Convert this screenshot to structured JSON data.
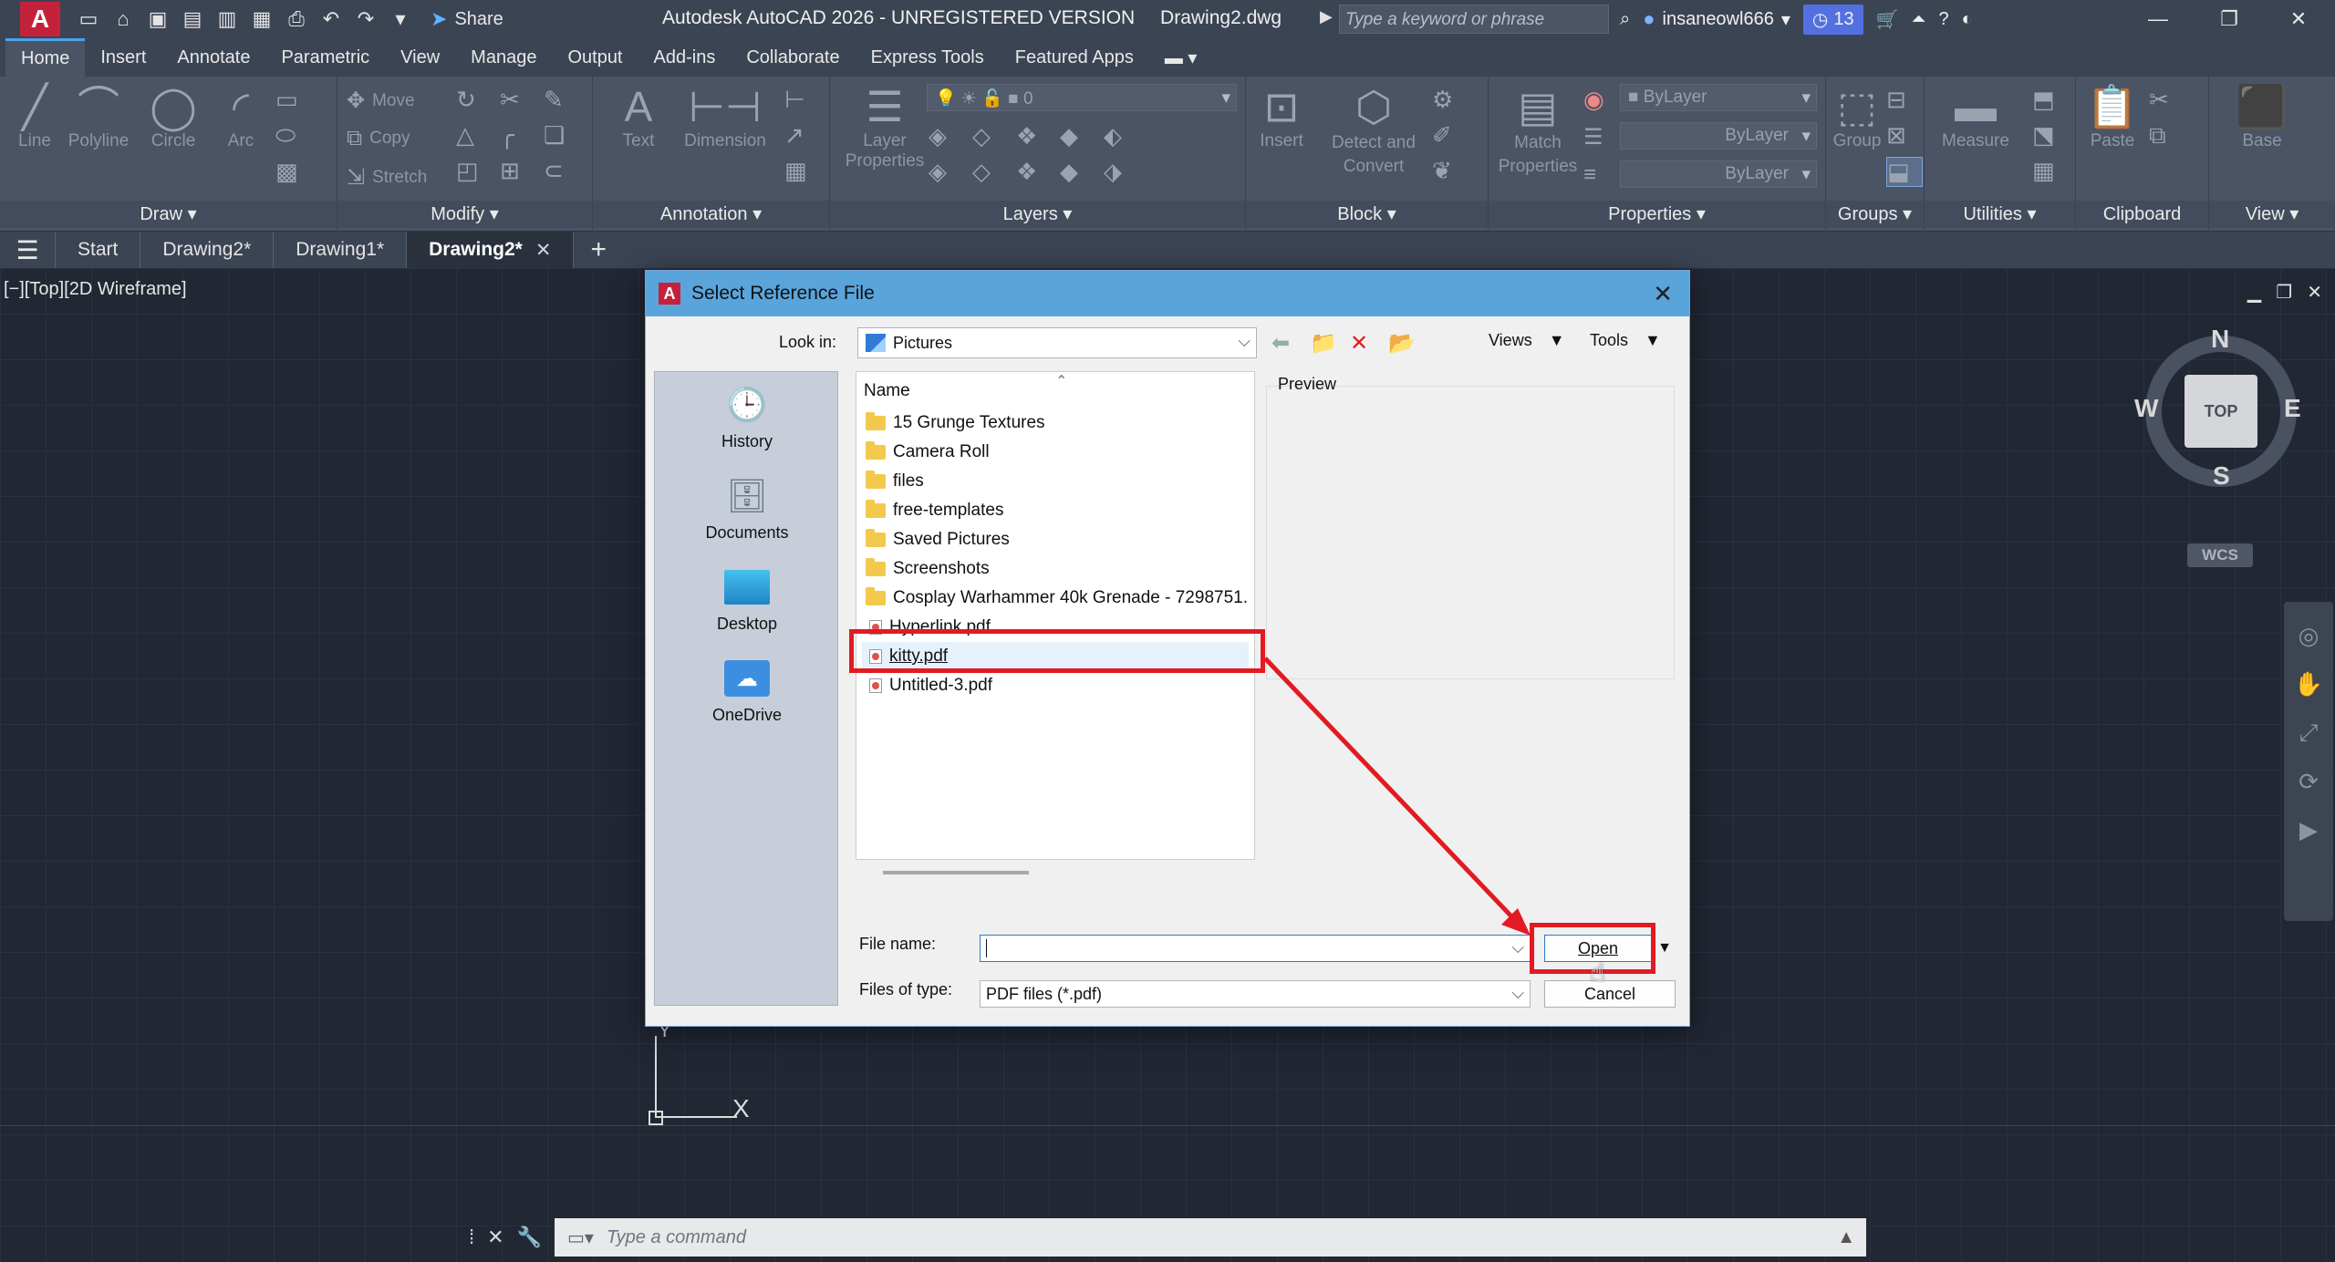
{
  "titlebar": {
    "app_logo": "A",
    "share_label": "Share",
    "window_title": "Autodesk AutoCAD 2026 - UNREGISTERED VERSION",
    "document_name": "Drawing2.dwg",
    "search_placeholder": "Type a keyword or phrase",
    "username": "insaneowl666",
    "notification_count": "13"
  },
  "ribbon_tabs": [
    "Home",
    "Insert",
    "Annotate",
    "Parametric",
    "View",
    "Manage",
    "Output",
    "Add-ins",
    "Collaborate",
    "Express Tools",
    "Featured Apps"
  ],
  "ribbon": {
    "draw": {
      "title": "Draw",
      "tools": [
        "Line",
        "Polyline",
        "Circle",
        "Arc"
      ]
    },
    "modify": {
      "title": "Modify",
      "move": "Move",
      "copy": "Copy",
      "stretch": "Stretch"
    },
    "annotation": {
      "title": "Annotation",
      "text": "Text",
      "dimension": "Dimension"
    },
    "layers": {
      "title": "Layers",
      "layer_properties": "Layer Properties",
      "current_layer": "0"
    },
    "block": {
      "title": "Block",
      "insert": "Insert",
      "detect_and_convert": "Detect and Convert"
    },
    "properties": {
      "title": "Properties",
      "match_properties": "Match Properties",
      "color": "ByLayer",
      "linetype": "ByLayer",
      "lineweight": "ByLayer"
    },
    "groups": {
      "title": "Groups",
      "group": "Group"
    },
    "utilities": {
      "title": "Utilities",
      "measure": "Measure"
    },
    "clipboard": {
      "title": "Clipboard",
      "paste": "Paste"
    },
    "view": {
      "title": "View",
      "base": "Base"
    }
  },
  "doc_tabs": {
    "start": "Start",
    "tabs": [
      "Drawing2*",
      "Drawing1*"
    ],
    "active": "Drawing2*"
  },
  "canvas": {
    "viewport_label": "[−][Top][2D Wireframe]",
    "viewcube": {
      "top": "TOP",
      "n": "N",
      "s": "S",
      "e": "E",
      "w": "W",
      "wcs": "WCS"
    },
    "ucs_x": "X",
    "ucs_y": "Y"
  },
  "command_line": {
    "placeholder": "Type a command"
  },
  "dialog": {
    "title": "Select Reference File",
    "look_in_label": "Look in:",
    "look_in_value": "Pictures",
    "views_label": "Views",
    "tools_label": "Tools",
    "places": [
      "History",
      "Documents",
      "Desktop",
      "OneDrive"
    ],
    "list_header": "Name",
    "files": [
      {
        "name": "15 Grunge Textures",
        "type": "folder"
      },
      {
        "name": "Camera Roll",
        "type": "folder"
      },
      {
        "name": "files",
        "type": "folder"
      },
      {
        "name": "free-templates",
        "type": "folder"
      },
      {
        "name": "Saved Pictures",
        "type": "folder"
      },
      {
        "name": "Screenshots",
        "type": "folder"
      },
      {
        "name": "Cosplay Warhammer 40k Grenade - 7298751.",
        "type": "folder"
      },
      {
        "name": "Hyperlink.pdf",
        "type": "pdf"
      },
      {
        "name": "kitty.pdf",
        "type": "pdf",
        "selected": true
      },
      {
        "name": "Untitled-3.pdf",
        "type": "pdf"
      }
    ],
    "preview_label": "Preview",
    "file_name_label": "File name:",
    "file_name_value": "",
    "files_of_type_label": "Files of type:",
    "files_of_type_value": "PDF files (*.pdf)",
    "open_label": "Open",
    "cancel_label": "Cancel"
  },
  "colors": {
    "annotation_red": "#e21a22",
    "dialog_titlebar": "#5aa4dc",
    "autocad_red": "#c4223b"
  }
}
